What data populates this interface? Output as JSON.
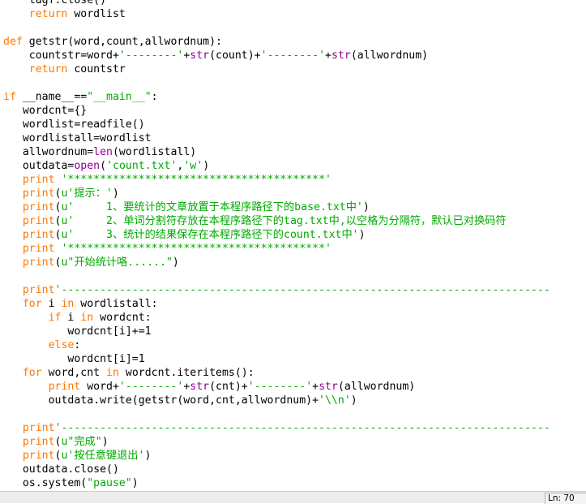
{
  "code_lines": [
    [
      [
        "",
        "    tagf.close()"
      ]
    ],
    [
      [
        "kw",
        "    return"
      ],
      [
        "",
        " wordlist"
      ]
    ],
    [
      [
        "",
        ""
      ]
    ],
    [
      [
        "kw",
        "def"
      ],
      [
        "",
        " getstr(word,count,allwordnum):"
      ]
    ],
    [
      [
        "",
        "    countstr=word+"
      ],
      [
        "st",
        "'--------'"
      ],
      [
        "",
        "+"
      ],
      [
        "bi",
        "str"
      ],
      [
        "",
        "(count)+"
      ],
      [
        "st",
        "'--------'"
      ],
      [
        "",
        "+"
      ],
      [
        "bi",
        "str"
      ],
      [
        "",
        "(allwordnum)"
      ]
    ],
    [
      [
        "kw",
        "    return"
      ],
      [
        "",
        " countstr"
      ]
    ],
    [
      [
        "",
        ""
      ]
    ],
    [
      [
        "kw",
        "if"
      ],
      [
        "",
        " __name__=="
      ],
      [
        "st",
        "\"__main__\""
      ],
      [
        "",
        ":"
      ]
    ],
    [
      [
        "",
        "   wordcnt={}"
      ]
    ],
    [
      [
        "",
        "   wordlist=readfile()"
      ]
    ],
    [
      [
        "",
        "   wordlistall=wordlist"
      ]
    ],
    [
      [
        "",
        "   allwordnum="
      ],
      [
        "bi",
        "len"
      ],
      [
        "",
        "(wordlistall)"
      ]
    ],
    [
      [
        "",
        "   outdata="
      ],
      [
        "bi",
        "open"
      ],
      [
        "",
        "("
      ],
      [
        "st",
        "'count.txt'"
      ],
      [
        "",
        ","
      ],
      [
        "st",
        "'w'"
      ],
      [
        "",
        ")"
      ]
    ],
    [
      [
        "kw",
        "   print"
      ],
      [
        "",
        " "
      ],
      [
        "st",
        "'****************************************'"
      ]
    ],
    [
      [
        "kw",
        "   print"
      ],
      [
        "",
        "("
      ],
      [
        "st",
        "u'提示：'"
      ],
      [
        "",
        ")"
      ]
    ],
    [
      [
        "kw",
        "   print"
      ],
      [
        "",
        "("
      ],
      [
        "st",
        "u'     1、要统计的文章放置于本程序路径下的base.txt中'"
      ],
      [
        "",
        ")"
      ]
    ],
    [
      [
        "kw",
        "   print"
      ],
      [
        "",
        "("
      ],
      [
        "st",
        "u'     2、单词分割符存放在本程序路径下的tag.txt中,以空格为分隔符，默认已对换码符"
      ],
      [
        "",
        ""
      ]
    ],
    [
      [
        "kw",
        "   print"
      ],
      [
        "",
        "("
      ],
      [
        "st",
        "u'     3、统计的结果保存在本程序路径下的count.txt中'"
      ],
      [
        "",
        ")"
      ]
    ],
    [
      [
        "kw",
        "   print"
      ],
      [
        "",
        " "
      ],
      [
        "st",
        "'****************************************'"
      ]
    ],
    [
      [
        "kw",
        "   print"
      ],
      [
        "",
        "("
      ],
      [
        "st",
        "u\"开始统计咯......\""
      ],
      [
        "",
        ")"
      ]
    ],
    [
      [
        "",
        ""
      ]
    ],
    [
      [
        "kw",
        "   print"
      ],
      [
        "st",
        "'----------------------------------------------------------------------------"
      ]
    ],
    [
      [
        "kw",
        "   for"
      ],
      [
        "",
        " i "
      ],
      [
        "kw",
        "in"
      ],
      [
        "",
        " wordlistall:"
      ]
    ],
    [
      [
        "kw",
        "       if"
      ],
      [
        "",
        " i "
      ],
      [
        "kw",
        "in"
      ],
      [
        "",
        " wordcnt:"
      ]
    ],
    [
      [
        "",
        "          wordcnt[i]+=1"
      ]
    ],
    [
      [
        "kw",
        "       else"
      ],
      [
        "",
        ":"
      ]
    ],
    [
      [
        "",
        "          wordcnt[i]=1"
      ]
    ],
    [
      [
        "kw",
        "   for"
      ],
      [
        "",
        " word,cnt "
      ],
      [
        "kw",
        "in"
      ],
      [
        "",
        " wordcnt.iteritems():"
      ]
    ],
    [
      [
        "kw",
        "       print"
      ],
      [
        "",
        " word+"
      ],
      [
        "st",
        "'--------'"
      ],
      [
        "",
        "+"
      ],
      [
        "bi",
        "str"
      ],
      [
        "",
        "(cnt)+"
      ],
      [
        "st",
        "'--------'"
      ],
      [
        "",
        "+"
      ],
      [
        "bi",
        "str"
      ],
      [
        "",
        "(allwordnum)"
      ]
    ],
    [
      [
        "",
        "       outdata.write(getstr(word,cnt,allwordnum)+"
      ],
      [
        "st",
        "'\\\\n'"
      ],
      [
        "",
        ")"
      ]
    ],
    [
      [
        "",
        ""
      ]
    ],
    [
      [
        "kw",
        "   print"
      ],
      [
        "st",
        "'----------------------------------------------------------------------------"
      ]
    ],
    [
      [
        "kw",
        "   print"
      ],
      [
        "",
        "("
      ],
      [
        "st",
        "u\"完成\""
      ],
      [
        "",
        ")"
      ]
    ],
    [
      [
        "kw",
        "   print"
      ],
      [
        "",
        "("
      ],
      [
        "st",
        "u'按任意键退出'"
      ],
      [
        "",
        ")"
      ]
    ],
    [
      [
        "",
        "   outdata.close()"
      ]
    ],
    [
      [
        "",
        "   os.system("
      ],
      [
        "st",
        "\"pause\""
      ],
      [
        "",
        ")"
      ]
    ]
  ],
  "status_bar": {
    "line_col": "Ln: 70"
  },
  "syntax_colors": {
    "keyword": "#ff7700",
    "builtin": "#900090",
    "string": "#00aa00",
    "default": "#000000"
  }
}
